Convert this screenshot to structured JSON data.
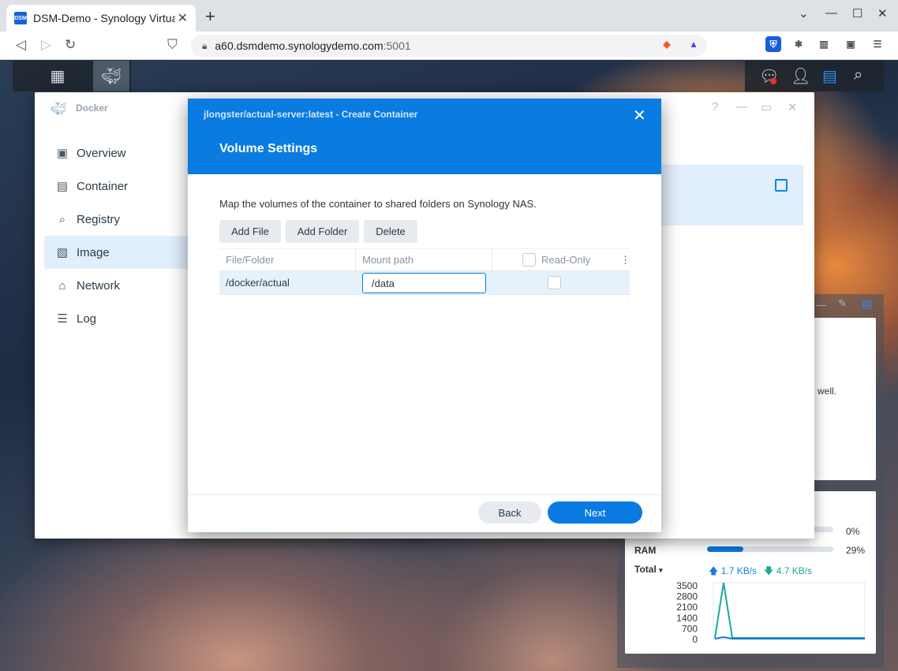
{
  "browser": {
    "tab_title": "DSM-Demo - Synology VirtualD",
    "favicon_text": "DSM",
    "url_host": "a60.dsmdemo.synologydemo.com",
    "url_port": ":5001"
  },
  "docker": {
    "title": "Docker",
    "sidebar": [
      {
        "label": "Overview",
        "icon": "overview-icon"
      },
      {
        "label": "Container",
        "icon": "container-icon"
      },
      {
        "label": "Registry",
        "icon": "registry-icon"
      },
      {
        "label": "Image",
        "icon": "image-icon",
        "selected": true
      },
      {
        "label": "Network",
        "icon": "network-icon"
      },
      {
        "label": "Log",
        "icon": "log-icon"
      }
    ]
  },
  "modal": {
    "subtitle": "jlongster/actual-server:latest - Create Container",
    "title": "Volume Settings",
    "description": "Map the volumes of the container to shared folders on Synology NAS.",
    "buttons": {
      "add_file": "Add File",
      "add_folder": "Add Folder",
      "delete": "Delete"
    },
    "columns": {
      "file_folder": "File/Folder",
      "mount_path": "Mount path",
      "read_only": "Read-Only"
    },
    "rows": [
      {
        "file_folder": "/docker/actual",
        "mount_path": "/data",
        "read_only": false
      }
    ],
    "back_label": "Back",
    "next_label": "Next"
  },
  "widget": {
    "partial_text": "well.",
    "cpu_pct_label": "0%",
    "cpu_pct": 0,
    "ram_label": "RAM",
    "ram_pct_label": "29%",
    "ram_pct": 29,
    "total_label": "Total",
    "upload": "1.7 KB/s",
    "download": "4.7 KB/s",
    "chart_ticks": [
      "3500",
      "2800",
      "2100",
      "1400",
      "700",
      "0"
    ]
  },
  "colors": {
    "accent": "#0a7be0",
    "upload": "#1a7ad4",
    "download": "#18a99a"
  }
}
